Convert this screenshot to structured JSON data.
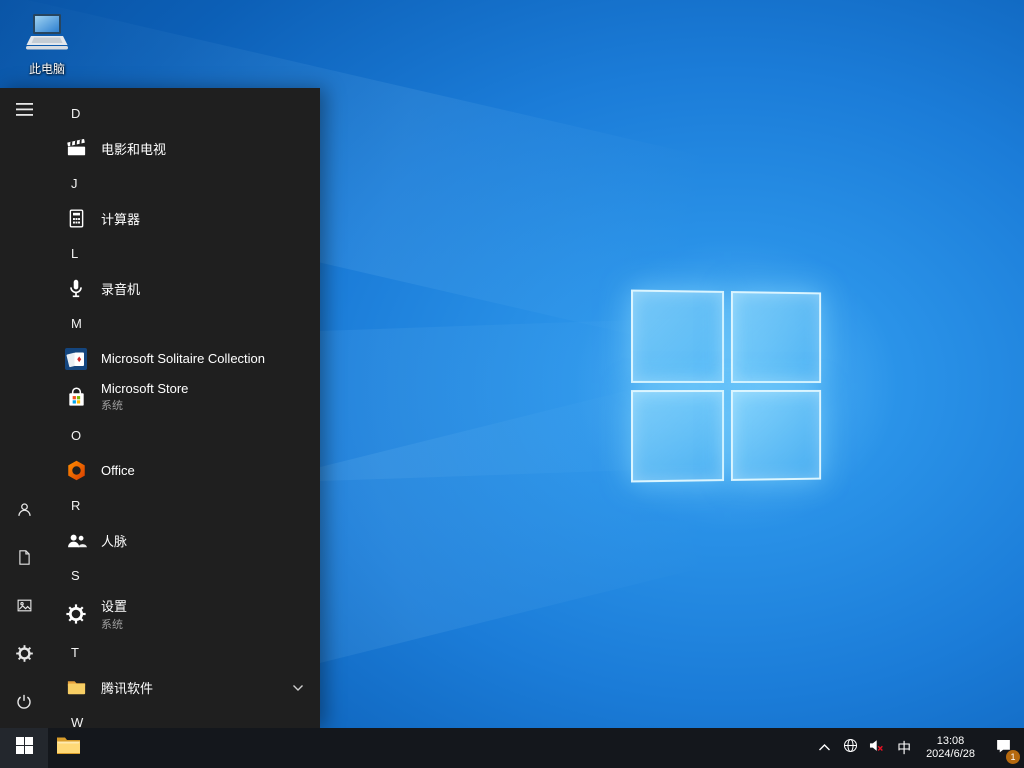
{
  "desktop": {
    "icons": [
      {
        "label": "此电脑",
        "icon": "laptop-icon"
      }
    ]
  },
  "start_menu": {
    "rail_icons": [
      "hamburger-icon",
      "user-avatar-icon",
      "documents-icon",
      "pictures-icon",
      "settings-gear-icon",
      "power-icon"
    ],
    "sections": [
      {
        "letter": "D",
        "apps": [
          {
            "label": "电影和电视",
            "icon": "movies-tv-icon"
          }
        ]
      },
      {
        "letter": "J",
        "apps": [
          {
            "label": "计算器",
            "icon": "calculator-icon"
          }
        ]
      },
      {
        "letter": "L",
        "apps": [
          {
            "label": "录音机",
            "icon": "voice-recorder-icon"
          }
        ]
      },
      {
        "letter": "M",
        "apps": [
          {
            "label": "Microsoft Solitaire Collection",
            "icon": "solitaire-icon"
          },
          {
            "label": "Microsoft Store",
            "sublabel": "系统",
            "icon": "store-icon"
          }
        ]
      },
      {
        "letter": "O",
        "apps": [
          {
            "label": "Office",
            "icon": "office-icon"
          }
        ]
      },
      {
        "letter": "R",
        "apps": [
          {
            "label": "人脉",
            "icon": "people-icon"
          }
        ]
      },
      {
        "letter": "S",
        "apps": [
          {
            "label": "设置",
            "sublabel": "系统",
            "icon": "settings-gear-icon"
          }
        ]
      },
      {
        "letter": "T",
        "apps": [
          {
            "label": "腾讯软件",
            "icon": "folder-icon",
            "expandable": true
          }
        ]
      },
      {
        "letter": "W",
        "apps": []
      }
    ]
  },
  "taskbar": {
    "icons": [
      "start-windows-icon",
      "file-explorer-icon",
      "chevron-up-icon",
      "network-globe-icon",
      "volume-muted-icon",
      "action-center-icon"
    ],
    "tray": {
      "ime": "中",
      "time": "13:08",
      "date": "2024/6/28",
      "notification_badge": "1"
    }
  },
  "colors": {
    "start_menu_bg": "#1f1f1f",
    "taskbar_bg": "#14171c",
    "wallpaper_blue": "#1b7cd8",
    "logo_glass": "#8cd7fa",
    "badge": "#b5690f",
    "folder_yellow": "#f7ce64",
    "office_orange": "#d83b01"
  }
}
